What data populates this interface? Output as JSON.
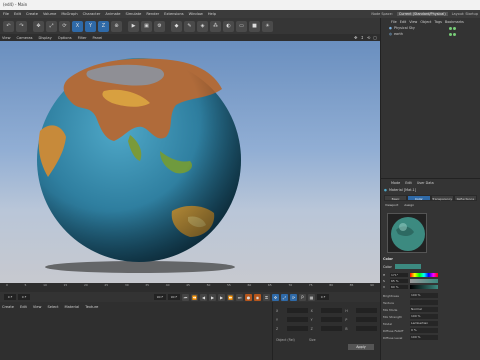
{
  "window": {
    "title": "(ed4) - Main"
  },
  "menubar": [
    "File",
    "Edit",
    "Create",
    "Volume",
    "MoGraph",
    "Character",
    "Animate",
    "Simulate",
    "Render",
    "Extensions",
    "Window",
    "Help"
  ],
  "layout_tabs": [
    "Node Space:",
    "Current (Standard/Physical)",
    "Layout: Startup"
  ],
  "viewport_menu": [
    "View",
    "Cameras",
    "Display",
    "Options",
    "Filter",
    "Panel"
  ],
  "timeline": {
    "ticks": [
      "0",
      "5",
      "10",
      "15",
      "20",
      "25",
      "30",
      "35",
      "40",
      "45",
      "50",
      "55",
      "60",
      "65",
      "70",
      "75",
      "80",
      "85",
      "90"
    ],
    "start_field": "0 F",
    "current_frame": "0 F",
    "end_field": "90 F",
    "end_field2": "90 F",
    "frame_readout": "0 F"
  },
  "bottom_left": {
    "menu": [
      "Create",
      "Edit",
      "View",
      "Select",
      "Material",
      "Texture"
    ]
  },
  "coords": {
    "rows": [
      {
        "a": "X",
        "b": "X",
        "c": "H"
      },
      {
        "a": "Y",
        "b": "Y",
        "c": "P"
      },
      {
        "a": "Z",
        "b": "Z",
        "c": "B"
      }
    ],
    "mode1": "Object (Rel)",
    "mode2": "Size",
    "apply": "Apply"
  },
  "object_manager": {
    "menu": [
      "File",
      "Edit",
      "View",
      "Object",
      "Tags",
      "Bookmarks"
    ],
    "objects": [
      "Physical Sky",
      "earth"
    ]
  },
  "material_panel": {
    "menu": [
      "Mode",
      "Edit",
      "User Data"
    ],
    "title": "Material [Mat.1]",
    "tabs": [
      "Basic",
      "Color",
      "Transparency",
      "Reflectance"
    ],
    "subtabs": [
      "Viewport",
      "Assign"
    ],
    "section": "Color",
    "color_label": "Color",
    "hsv": [
      {
        "k": "H",
        "v": "171°"
      },
      {
        "k": "S",
        "v": "65 %"
      },
      {
        "k": "V",
        "v": "60 %"
      }
    ],
    "brightness_label": "Brightness",
    "brightness": "100 %",
    "props": [
      {
        "k": "Texture",
        "v": ""
      },
      {
        "k": "Mix Mode",
        "v": "Normal"
      },
      {
        "k": "Mix Strength",
        "v": "100 %"
      },
      {
        "k": "Model",
        "v": "Lambertian"
      },
      {
        "k": "Diffuse Falloff",
        "v": "0 %"
      },
      {
        "k": "Diffuse Level",
        "v": "100 %"
      }
    ],
    "swatch_color": "#3c8a80"
  }
}
